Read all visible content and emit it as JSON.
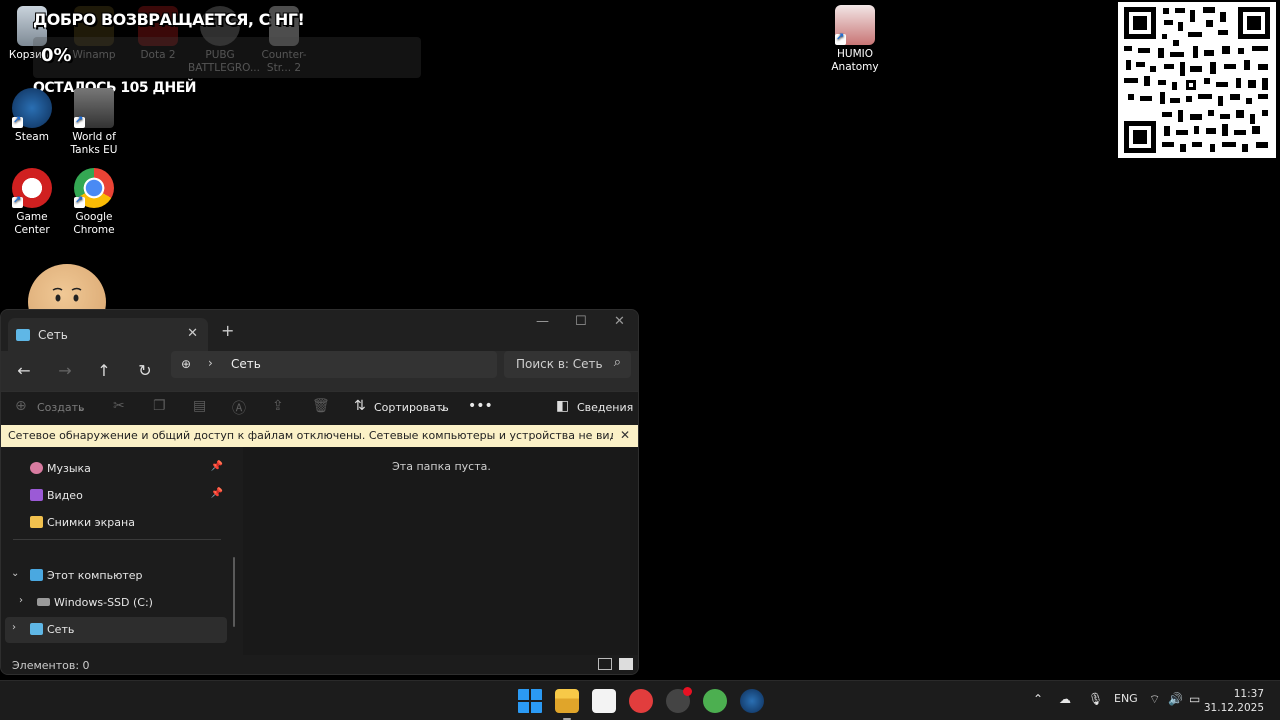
{
  "desktop": {
    "icons_left_top": [
      {
        "label": "Корзина"
      },
      {
        "label": "Winamp"
      },
      {
        "label": "Dota 2"
      },
      {
        "label": "PUBG BATTLEGRO..."
      },
      {
        "label": "Counter-Str... 2"
      }
    ],
    "icons_left": [
      {
        "label": "Steam"
      },
      {
        "label": "World of Tanks EU"
      },
      {
        "label": "Game Center"
      },
      {
        "label": "Google Chrome"
      }
    ],
    "icon_right": {
      "label": "HUMIO Anatomy"
    }
  },
  "overlay": {
    "welcome": "ДОБРО ВОЗВРАЩАЕТСЯ, С НГ!",
    "percent": "0%",
    "days_left": "ОСТАЛОСЬ 105 ДНЕЙ"
  },
  "explorer": {
    "tab_title": "Сеть",
    "address_path": "Сеть",
    "search_placeholder": "Поиск в: Сеть",
    "commands": {
      "create": "Создать",
      "sort": "Сортировать",
      "details": "Сведения"
    },
    "info_bar": "Сетевое обнаружение и общий доступ к файлам отключены. Сетевые компьютеры и устройства не видны. Щелкните для изменения...",
    "nav": [
      {
        "label": "Музыка",
        "pinned": true
      },
      {
        "label": "Видео",
        "pinned": true
      },
      {
        "label": "Снимки экрана",
        "pinned": false
      },
      {
        "label": "Этот компьютер"
      },
      {
        "label": "Windows-SSD (C:)"
      },
      {
        "label": "Сеть",
        "selected": true
      }
    ],
    "empty_message": "Эта папка пуста.",
    "status": "Элементов: 0"
  },
  "taskbar": {
    "language": "ENG",
    "time": "11:37",
    "date": "31.12.2025"
  },
  "colors": {
    "infobar_bg": "#fbf1c7",
    "window_bg": "#1c1c1c"
  }
}
